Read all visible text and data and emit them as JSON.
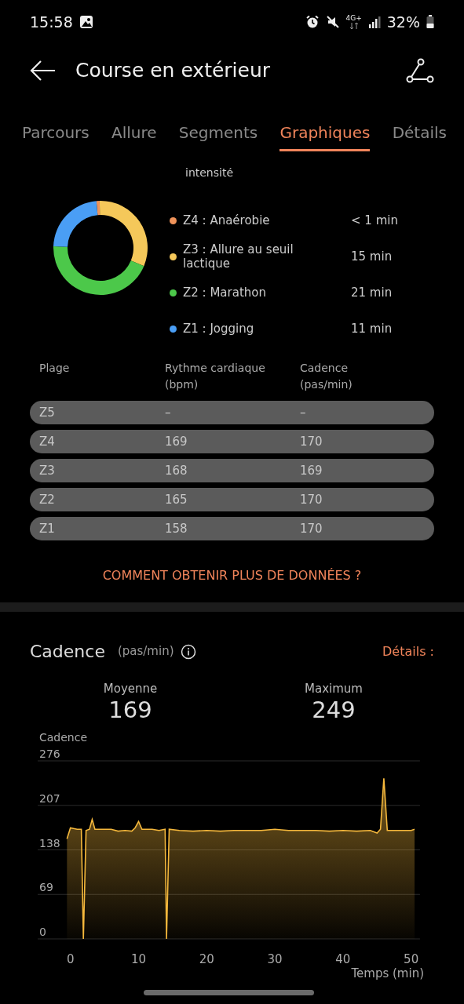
{
  "status_bar": {
    "time": "15:58",
    "network": "4G+",
    "battery": "32%"
  },
  "header": {
    "title": "Course en extérieur"
  },
  "tabs": [
    {
      "label": "Parcours",
      "selected": false
    },
    {
      "label": "Allure",
      "selected": false
    },
    {
      "label": "Segments",
      "selected": false
    },
    {
      "label": "Graphiques",
      "selected": true
    },
    {
      "label": "Détails",
      "selected": false
    }
  ],
  "zones": {
    "title_fragment": "intensité",
    "chart_data": {
      "type": "donut",
      "categories": [
        "Z4 : Anaérobie",
        "Z3 : Allure au seuil lactique",
        "Z2 : Marathon",
        "Z1 : Jogging"
      ],
      "values": [
        1.1,
        31.6,
        44.2,
        23.1
      ]
    },
    "legend": [
      {
        "duration": "< 1 min",
        "color": "#f0935a"
      },
      {
        "duration": "15 min",
        "color": "#f5c85a"
      },
      {
        "duration": "21 min",
        "color": "#4cc84a"
      },
      {
        "duration": "11 min",
        "color": "#4a9ef5"
      }
    ]
  },
  "zone_table": {
    "columns": [
      "Plage",
      "Rythme cardiaque (bpm)",
      "Cadence (pas/min)"
    ],
    "rows": [
      [
        "Z5",
        "–",
        "–"
      ],
      [
        "Z4",
        "169",
        "170"
      ],
      [
        "Z3",
        "168",
        "169"
      ],
      [
        "Z2",
        "165",
        "170"
      ],
      [
        "Z1",
        "158",
        "170"
      ]
    ]
  },
  "more_data_link": "COMMENT OBTENIR PLUS DE DONNÉES ?",
  "cadence": {
    "title": "Cadence",
    "unit": "(pas/min)",
    "details_link": "Détails :",
    "stats": [
      {
        "label": "Moyenne",
        "value": "169"
      },
      {
        "label": "Maximum",
        "value": "249"
      }
    ],
    "chart_data": {
      "type": "area",
      "ylabel": "Cadence",
      "xlabel": "Temps (min)",
      "xlim": [
        -4.8,
        51.3
      ],
      "ylim": [
        0,
        276
      ],
      "grid": true,
      "xticks": [
        0,
        10,
        20,
        30,
        40,
        50
      ],
      "yticks": [
        0,
        69,
        138,
        207,
        276
      ],
      "x": [
        -0.5,
        0,
        1,
        1.6,
        1.9,
        2.3,
        2.8,
        3.2,
        3.6,
        5,
        6,
        7,
        8,
        9,
        9.5,
        10,
        10.5,
        12,
        13,
        13.9,
        14.1,
        14.5,
        16,
        18,
        20,
        22,
        24,
        26,
        28,
        30,
        32,
        34,
        36,
        38,
        40,
        42,
        44,
        45,
        45.5,
        46,
        46.5,
        48,
        50,
        50.5
      ],
      "series": [
        {
          "color": "#f5b83c",
          "values": [
            155,
            172,
            170,
            170,
            0,
            168,
            170,
            185,
            170,
            170,
            170,
            167,
            168,
            167,
            172,
            182,
            170,
            170,
            168,
            170,
            0,
            170,
            168,
            167,
            168,
            167,
            168,
            168,
            168,
            170,
            168,
            168,
            168,
            167,
            168,
            167,
            168,
            164,
            170,
            249,
            168,
            168,
            168,
            170
          ]
        }
      ]
    }
  }
}
